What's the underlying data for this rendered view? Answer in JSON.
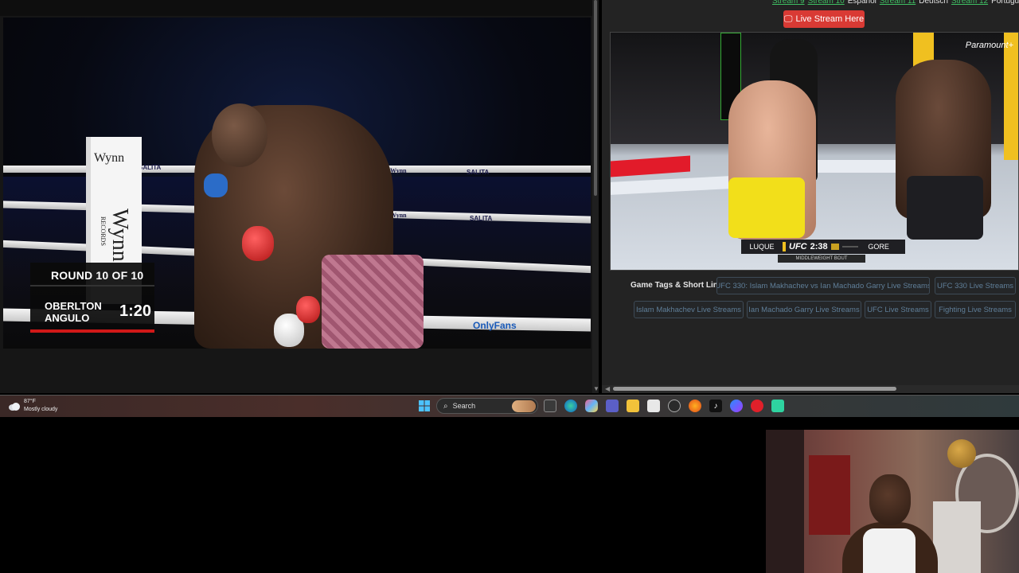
{
  "left_stream": {
    "scoreboard": {
      "round": "ROUND 10 OF 10",
      "fighter1": "OBERLTON",
      "fighter2": "ANGULO",
      "time": "1:20"
    },
    "brands": {
      "wynn": "Wynn",
      "records": "RECORDS",
      "salita": "SALITA",
      "onlyfans": "OnlyFans"
    }
  },
  "right_pane": {
    "stream_links": [
      {
        "label": "Stream 9",
        "style": "link"
      },
      {
        "label": "Stream 10",
        "style": "link"
      },
      {
        "label": "Español",
        "style": "plain"
      },
      {
        "label": "Stream 11",
        "style": "link"
      },
      {
        "label": "Deutsch",
        "style": "plain"
      },
      {
        "label": "Stream 12",
        "style": "link"
      },
      {
        "label": "Português",
        "style": "plain"
      }
    ],
    "live_button": "Live Stream Here",
    "live_icon": "monitor-icon",
    "ufc_overlay": {
      "fighter1": "LUQUE",
      "logo": "UFC",
      "time": "2:38",
      "fighter2": "GORE",
      "bout": "MIDDLEWEIGHT BOUT",
      "broadcaster": "Paramount+"
    },
    "tags_label": "Game Tags & Short Links:",
    "tags": [
      "UFC 330: Islam Makhachev vs Ian Machado Garry Live Streams",
      "UFC 330 Live Streams",
      "Islam Makhachev Live Streams",
      "Ian Machado Garry Live Streams",
      "UFC Live Streams",
      "Fighting Live Streams"
    ]
  },
  "taskbar": {
    "weather_temp": "87°F",
    "weather_desc": "Mostly cloudy",
    "search_label": "Search",
    "icons": [
      "windows-start-icon",
      "task-view-icon",
      "edge-icon",
      "copilot-icon",
      "teams-icon",
      "file-explorer-icon",
      "store-icon",
      "obs-icon",
      "firefox-icon",
      "tiktok-icon",
      "messenger-icon",
      "opera-icon",
      "green-app-icon"
    ]
  },
  "colors": {
    "accent_red": "#d93a34",
    "link_green": "#3fbf63",
    "tag_text": "#5f7e98"
  }
}
